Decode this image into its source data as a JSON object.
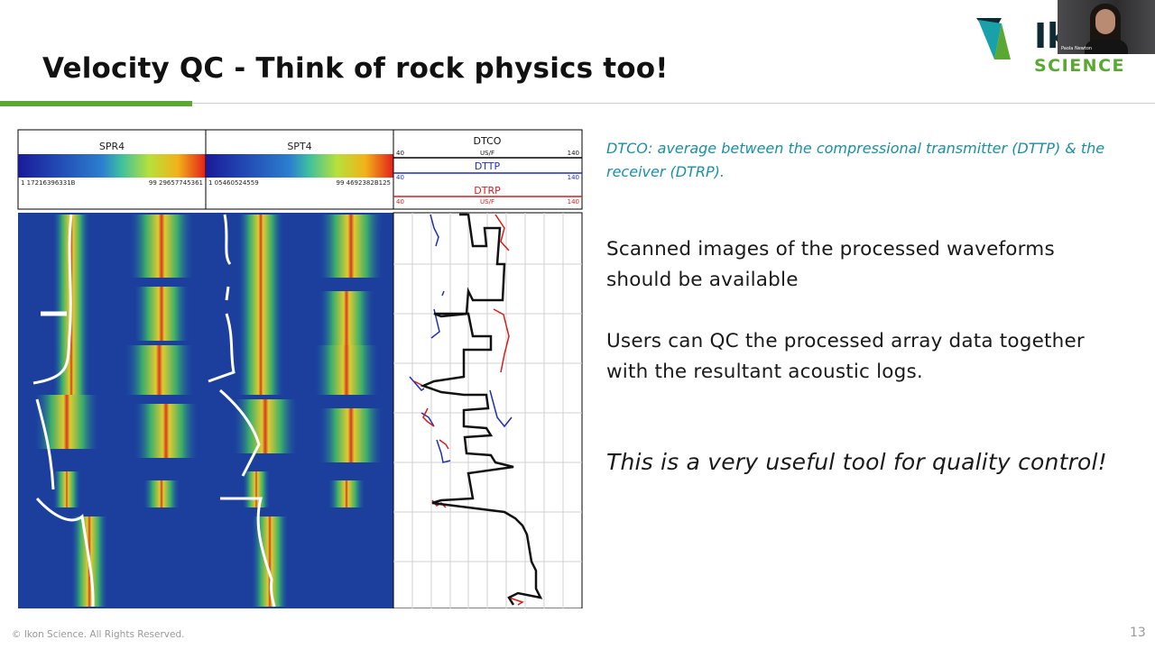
{
  "slide": {
    "title": "Velocity QC - Think of rock physics too!",
    "slide_number": "13",
    "copyright": "© Ikon Science. All Rights Reserved."
  },
  "logo": {
    "partial_text": "Ik",
    "word": "SCIENCE",
    "colors": {
      "teal": "#1aa0a8",
      "dark": "#0e2b33",
      "green": "#5aa832"
    }
  },
  "video": {
    "participant_name": "Paola Newton"
  },
  "figure": {
    "tracks": [
      {
        "label": "SPR4",
        "min_value": "1 17216396331B",
        "max_value": "99 29657745361"
      },
      {
        "label": "SPT4",
        "min_value": "1 05460524559",
        "max_value": "99 4692382B125"
      }
    ],
    "curve_track": {
      "curves": [
        {
          "name": "DTCO",
          "unit": "US/F",
          "min": "40",
          "max": "140",
          "color": "#000000"
        },
        {
          "name": "DTTP",
          "unit": "",
          "min": "40",
          "max": "140",
          "color": "#1f2fb8"
        },
        {
          "name": "DTRP",
          "unit": "US/F",
          "min": "40",
          "max": "140",
          "color": "#d61d1d"
        }
      ]
    }
  },
  "text": {
    "caption": "DTCO: average between the compressional transmitter (DTTP) & the receiver (DTRP).",
    "para1": "Scanned images of the processed waveforms should be available",
    "para2": "Users can QC the processed array data together with the resultant acoustic logs.",
    "para3": "This is a very useful tool for quality control!"
  }
}
